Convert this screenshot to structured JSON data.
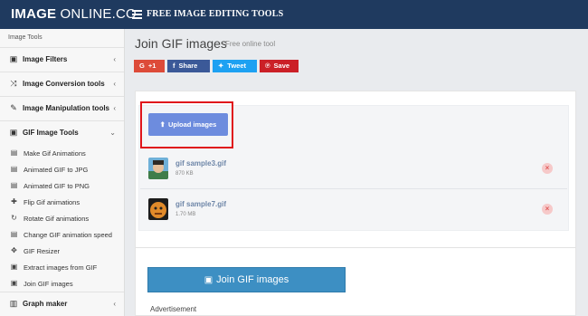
{
  "header": {
    "logo_bold": "IMAGE",
    "logo_light": "ONLINE.CO",
    "nav_title": "FREE IMAGE EDITING TOOLS"
  },
  "sidebar": {
    "heading": "Image Tools",
    "items": [
      {
        "label": "Image Filters",
        "icon": "image-icon",
        "chevron": "‹"
      },
      {
        "label": "Image Conversion tools",
        "icon": "shuffle-icon",
        "chevron": "‹"
      },
      {
        "label": "Image Manipulation tools",
        "icon": "wrench-icon",
        "chevron": "‹"
      },
      {
        "label": "GIF Image Tools",
        "icon": "image-icon",
        "chevron": "⌄"
      }
    ],
    "sub_items": [
      {
        "label": "Make Gif Animations",
        "icon": "film-icon"
      },
      {
        "label": "Animated GIF to JPG",
        "icon": "film-icon"
      },
      {
        "label": "Animated GIF to PNG",
        "icon": "film-icon"
      },
      {
        "label": "Flip Gif animations",
        "icon": "plus-icon"
      },
      {
        "label": "Rotate Gif animations",
        "icon": "rotate-icon"
      },
      {
        "label": "Change GIF animation speed",
        "icon": "film-icon"
      },
      {
        "label": "GIF Resizer",
        "icon": "move-icon"
      },
      {
        "label": "Extract images from GIF",
        "icon": "image-icon"
      },
      {
        "label": "Join GIF images",
        "icon": "image-icon"
      }
    ],
    "last_item": {
      "label": "Graph maker",
      "icon": "chart-icon",
      "chevron": "‹"
    }
  },
  "main": {
    "title": "Join GIF images",
    "subtitle": "Free online tool",
    "share": {
      "gplus": "+1",
      "facebook": "Share",
      "twitter": "Tweet",
      "pinterest": "Save"
    },
    "upload_label": "Upload images",
    "files": [
      {
        "name": "gif sample3.gif",
        "size": "870 KB"
      },
      {
        "name": "gif sample7.gif",
        "size": "1.70 MB"
      }
    ],
    "join_label": "Join GIF images",
    "ad_label": "Advertisement"
  }
}
